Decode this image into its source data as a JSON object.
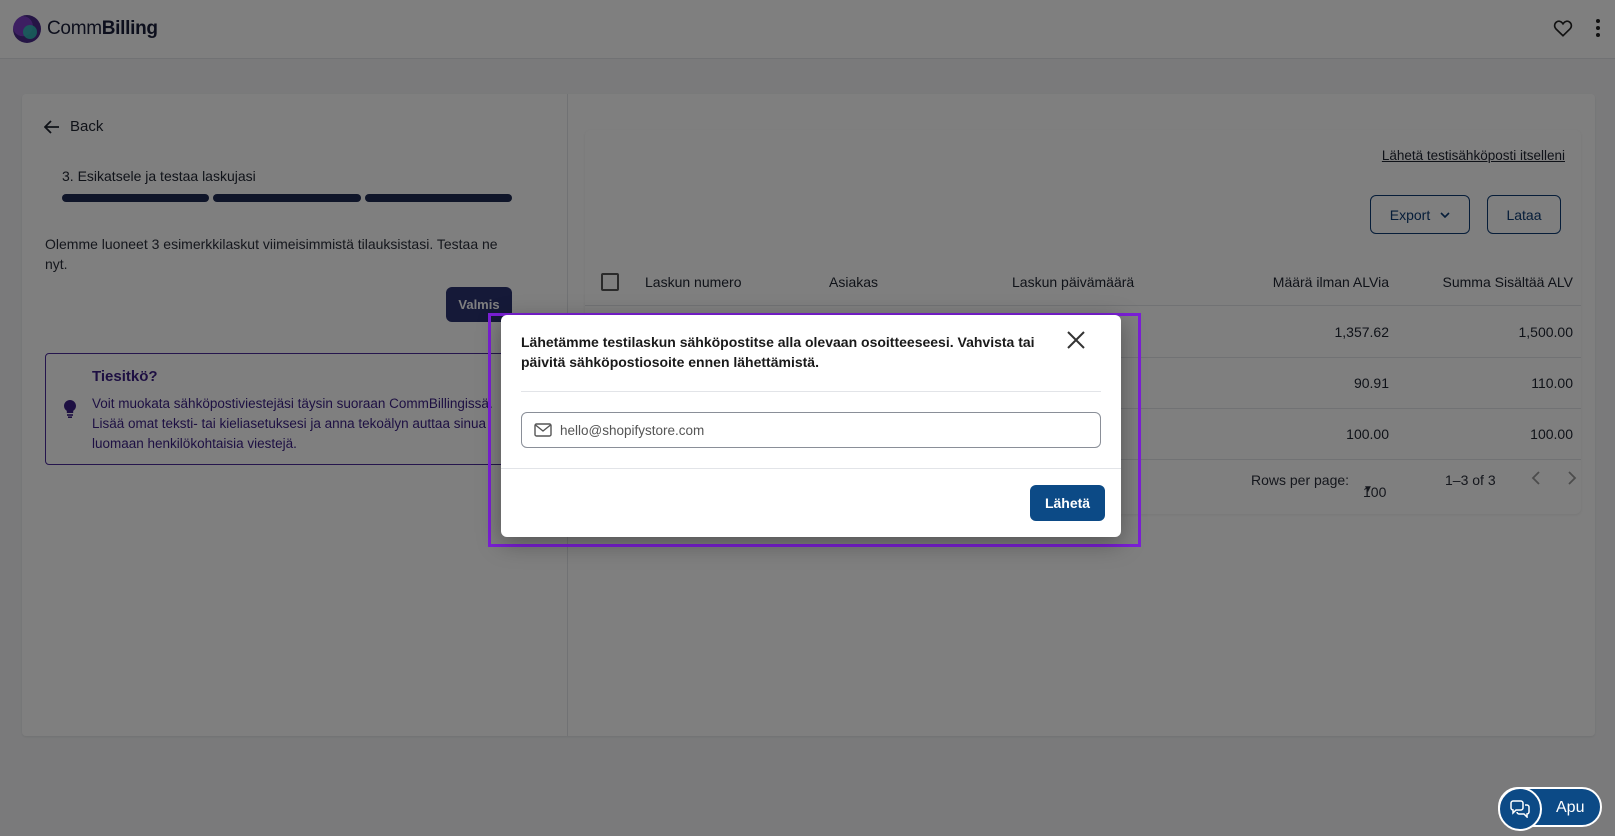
{
  "app": {
    "name_regular": "Comm",
    "name_bold": "Billing"
  },
  "left": {
    "back_label": "Back",
    "step_title": "3. Esikatsele ja testaa laskujasi",
    "description": "Olemme luoneet 3 esimerkkilaskut viimeisimmistä tilauksistasi. Testaa ne nyt.",
    "done_label": "Valmis",
    "tip": {
      "title": "Tiesitkö?",
      "text": "Voit muokata sähköpostiviestejäsi täysin suoraan CommBillingissä. Lisää omat teksti- tai kieliasetuksesi ja anna tekoälyn auttaa sinua luomaan henkilökohtaisia viestejä."
    }
  },
  "table": {
    "test_email_link": "Lähetä testisähköposti itselleni",
    "export_label": "Export",
    "load_label": "Lataa",
    "headers": {
      "number": "Laskun numero",
      "customer": "Asiakas",
      "date": "Laskun päivämäärä",
      "amount_ex_vat": "Määrä ilman ALVia",
      "total_inc_vat": "Summa Sisältää ALV"
    },
    "rows": [
      {
        "amount": "1,357.62",
        "total": "1,500.00"
      },
      {
        "amount": "90.91",
        "total": "110.00"
      },
      {
        "amount": "100.00",
        "total": "100.00"
      }
    ],
    "pager": {
      "rows_per_page_label": "Rows per page:",
      "rows_per_page_value": "100",
      "range": "1–3 of 3"
    }
  },
  "modal": {
    "message": "Lähetämme testilaskun sähköpostitse alla olevaan osoitteeseesi. Vahvista tai päivitä sähköpostiosoite ennen lähettämistä.",
    "email_value": "hello@shopifystore.com",
    "send_label": "Lähetä"
  },
  "help": {
    "label": "Apu"
  },
  "colors": {
    "brand_navy": "#0c4a86",
    "progress": "#1e2a52",
    "tip_purple": "#3a1f85",
    "highlight": "#7b1fd6"
  }
}
